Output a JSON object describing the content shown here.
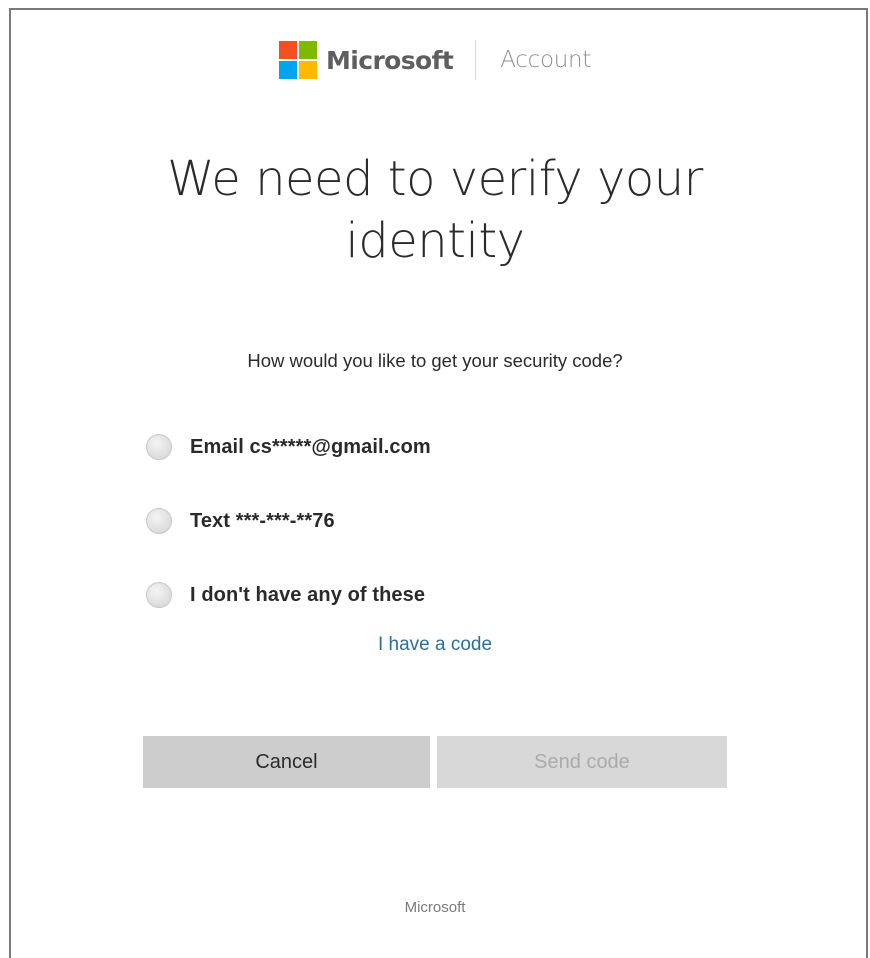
{
  "header": {
    "brand": "Microsoft",
    "section": "Account",
    "logo_colors": [
      "#f25022",
      "#7fba00",
      "#00a4ef",
      "#ffb900"
    ]
  },
  "title": {
    "line1": "We need to verify your",
    "line2": "identity"
  },
  "question": "How would you like to get your security code?",
  "options": [
    {
      "label": "Email cs*****@gmail.com",
      "selected": false
    },
    {
      "label": "Text ***-***-**76",
      "selected": false
    },
    {
      "label": "I don't have any of these",
      "selected": false
    }
  ],
  "have_code_link": "I have a code",
  "buttons": {
    "cancel": "Cancel",
    "send": "Send code"
  },
  "footer": "Microsoft"
}
